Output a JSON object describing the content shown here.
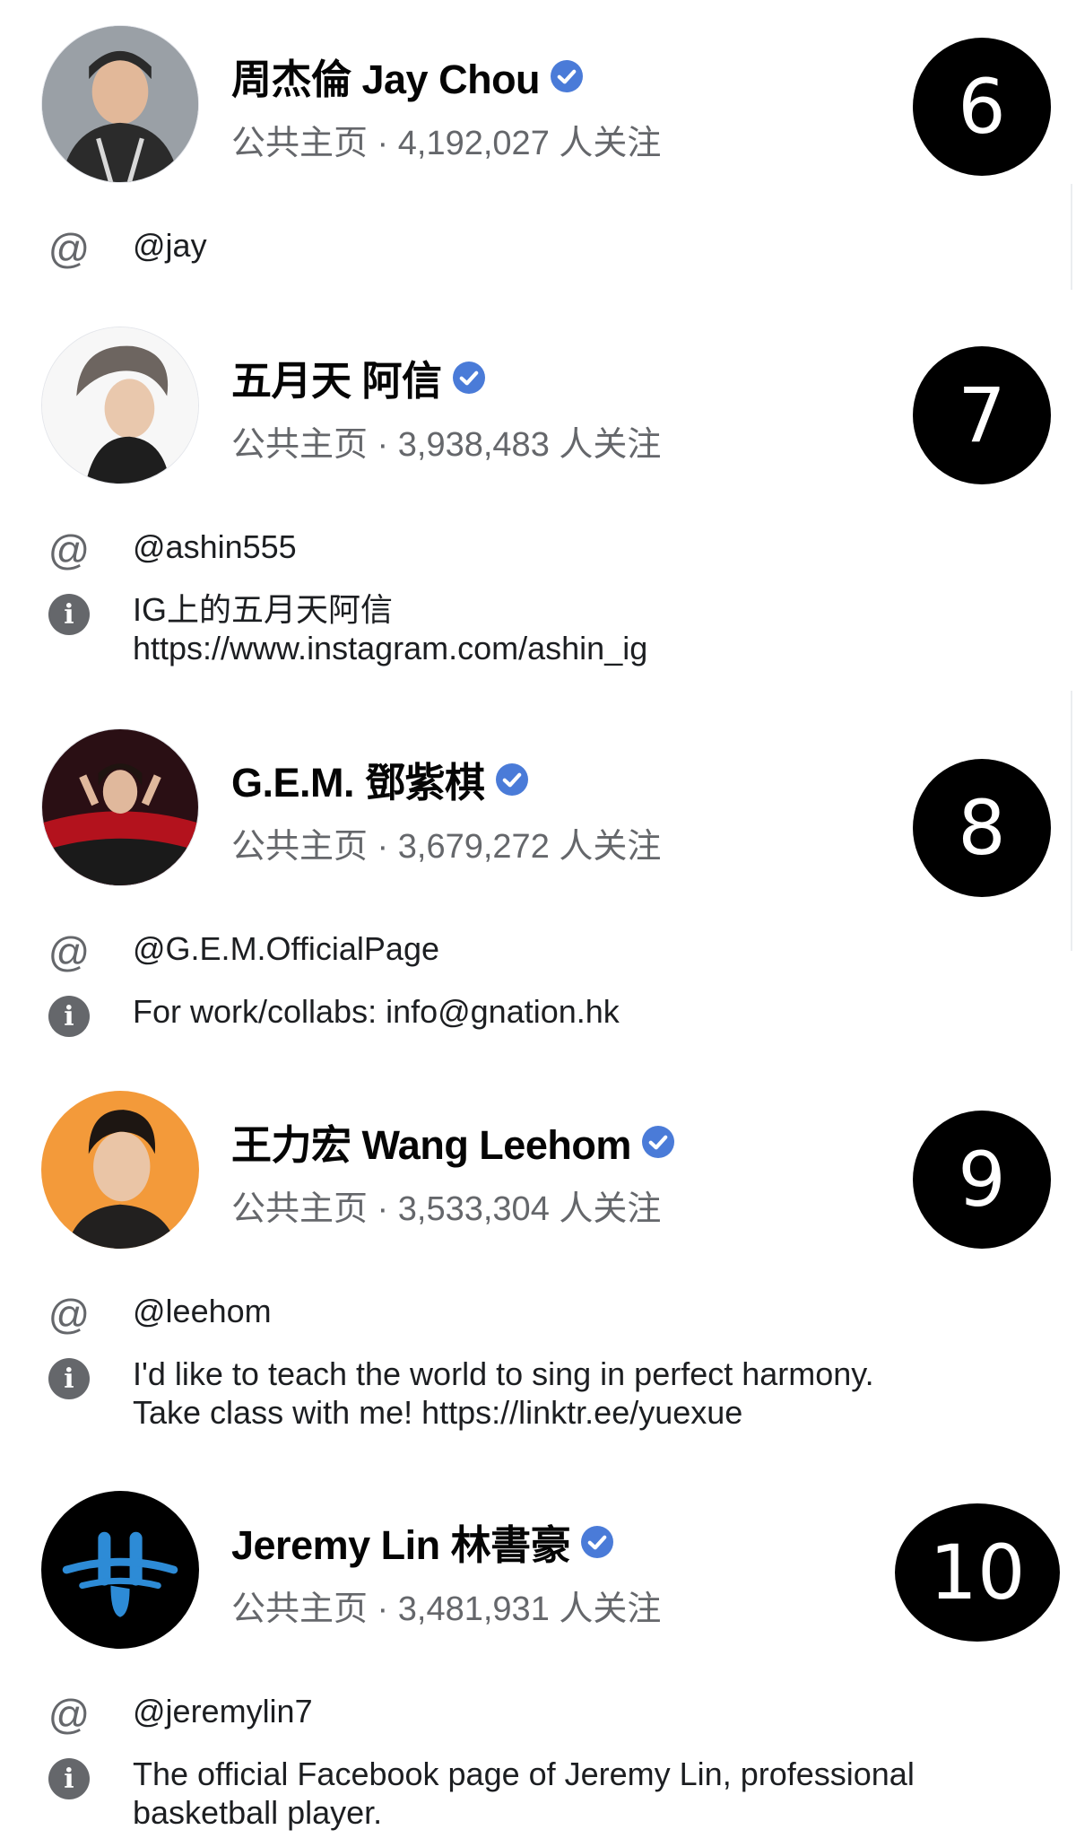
{
  "colors": {
    "verified_blue": "#4a7bd8",
    "secondary_text": "#65676b",
    "badge_bg": "#000000"
  },
  "entries": [
    {
      "rank": "6",
      "name": "周杰倫 Jay Chou",
      "meta": "公共主页 · 4,192,027 人关注",
      "handle": "@jay",
      "info_lines": []
    },
    {
      "rank": "7",
      "name": "五月天 阿信",
      "meta": "公共主页 · 3,938,483 人关注",
      "handle": "@ashin555",
      "info_lines": [
        "IG上的五月天阿信",
        "https://www.instagram.com/ashin_ig"
      ]
    },
    {
      "rank": "8",
      "name": "G.E.M. 鄧紫棋",
      "meta": "公共主页 · 3,679,272 人关注",
      "handle": "@G.E.M.OfficialPage",
      "info_lines": [
        "For work/collabs: info@gnation.hk"
      ]
    },
    {
      "rank": "9",
      "name": "王力宏 Wang Leehom",
      "meta": "公共主页 · 3,533,304 人关注",
      "handle": "@leehom",
      "info_lines": [
        "I'd like to teach the world to sing in perfect harmony.",
        "Take class with me! https://linktr.ee/yuexue"
      ]
    },
    {
      "rank": "10",
      "name": "Jeremy Lin 林書豪",
      "meta": "公共主页 · 3,481,931 人关注",
      "handle": "@jeremylin7",
      "info_lines": [
        "The official Facebook page of Jeremy Lin, professional",
        "basketball player."
      ]
    }
  ]
}
